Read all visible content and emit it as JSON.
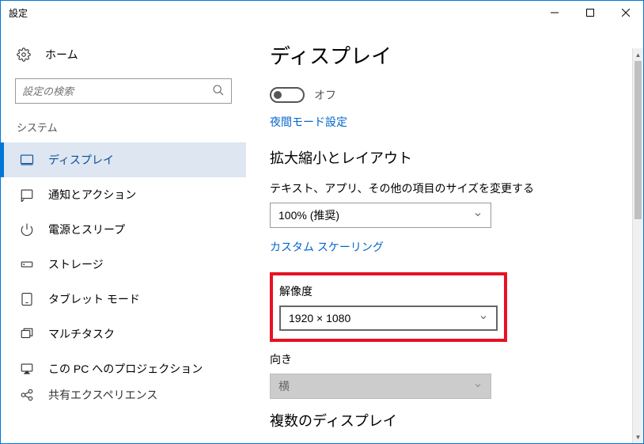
{
  "window": {
    "title": "設定"
  },
  "sidebar": {
    "home_label": "ホーム",
    "search_placeholder": "設定の検索",
    "category_label": "システム",
    "items": [
      {
        "label": "ディスプレイ"
      },
      {
        "label": "通知とアクション"
      },
      {
        "label": "電源とスリープ"
      },
      {
        "label": "ストレージ"
      },
      {
        "label": "タブレット モード"
      },
      {
        "label": "マルチタスク"
      },
      {
        "label": "この PC へのプロジェクション"
      },
      {
        "label": "共有エクスペリエンス"
      }
    ]
  },
  "content": {
    "page_title": "ディスプレイ",
    "toggle_label": "オフ",
    "nightlight_link": "夜間モード設定",
    "layout_heading": "拡大縮小とレイアウト",
    "scale_label": "テキスト、アプリ、その他の項目のサイズを変更する",
    "scale_value": "100% (推奨)",
    "custom_scaling_link": "カスタム スケーリング",
    "resolution_label": "解像度",
    "resolution_value": "1920 × 1080",
    "orientation_label": "向き",
    "orientation_value": "横",
    "multi_display_heading": "複数のディスプレイ"
  }
}
